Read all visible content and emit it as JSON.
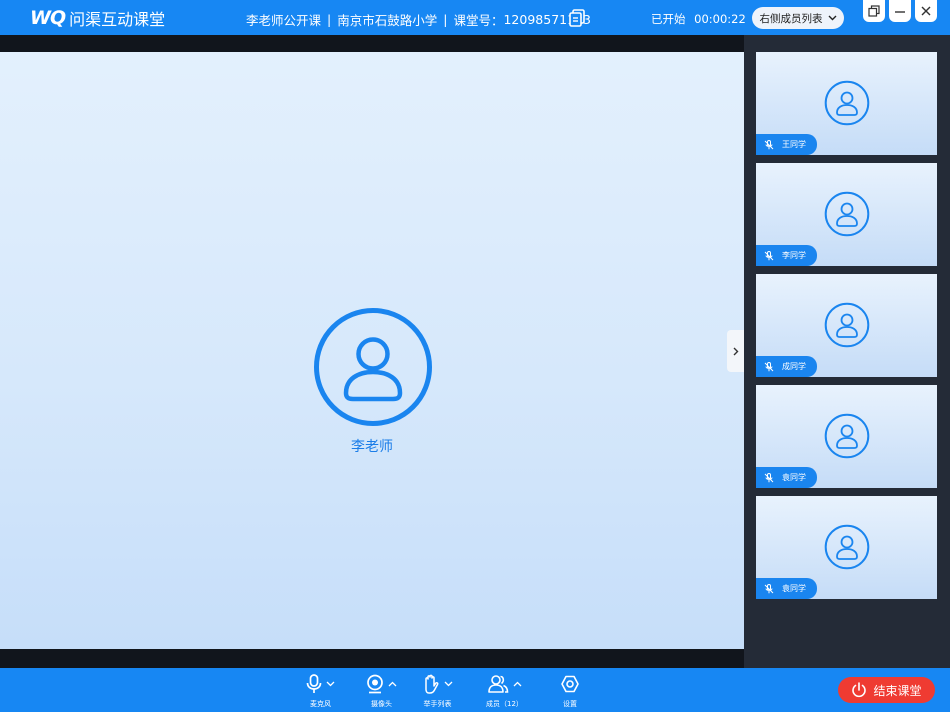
{
  "app": {
    "logo_mark": "WQ",
    "logo_text": "问渠互动课堂"
  },
  "header": {
    "course_title": "李老师公开课",
    "separator": "|",
    "school": "南京市石鼓路小学",
    "class_label": "课堂号：",
    "class_number": "12098571123",
    "status": "已开始",
    "elapsed": "00:00:22",
    "layout_select": "右侧成员列表"
  },
  "main": {
    "teacher_name": "李老师"
  },
  "sidebar": {
    "members": [
      {
        "name": "王同学"
      },
      {
        "name": "李同学"
      },
      {
        "name": "成同学"
      },
      {
        "name": "袁同学"
      },
      {
        "name": "袁同学"
      }
    ]
  },
  "toolbar": {
    "mic": "麦克风",
    "camera": "摄像头",
    "hands": "举手列表",
    "members": "成员（12）",
    "settings": "设置",
    "end_class": "结束课堂"
  },
  "colors": {
    "brand": "#1787f3",
    "danger": "#ef3b32",
    "sidebar": "#242b37"
  }
}
